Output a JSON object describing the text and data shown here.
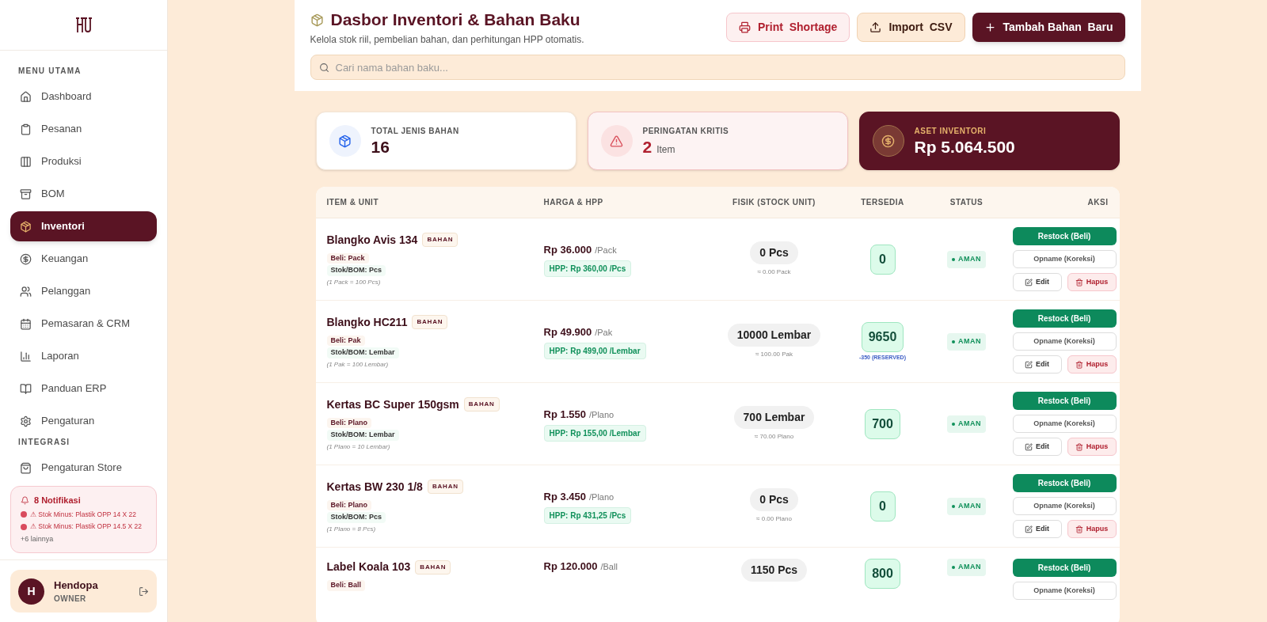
{
  "sidebar": {
    "sections": [
      {
        "title": "MENU UTAMA",
        "items": [
          {
            "label": "Dashboard",
            "selected": false
          },
          {
            "label": "Pesanan",
            "selected": false
          },
          {
            "label": "Produksi",
            "selected": false
          },
          {
            "label": "BOM",
            "selected": false
          },
          {
            "label": "Inventori",
            "selected": true
          },
          {
            "label": "Keuangan",
            "selected": false
          },
          {
            "label": "Pelanggan",
            "selected": false
          },
          {
            "label": "Pemasaran & CRM",
            "selected": false
          },
          {
            "label": "Laporan",
            "selected": false
          },
          {
            "label": "Panduan ERP",
            "selected": false
          },
          {
            "label": "Pengaturan",
            "selected": false
          }
        ]
      },
      {
        "title": "INTEGRASI",
        "items": [
          {
            "label": "Pengaturan Store",
            "selected": false
          }
        ]
      }
    ],
    "notifications": {
      "title": "8 Notifikasi",
      "items": [
        "⚠ Stok Minus: Plastik OPP 14 X 22",
        "⚠ Stok Minus: Plastik OPP 14.5 X 22"
      ],
      "more": "+6 lainnya"
    },
    "user": {
      "initial": "H",
      "name": "Hendopa",
      "role": "OWNER"
    }
  },
  "header": {
    "title": "Dasbor Inventori & Bahan Baku",
    "subtitle": "Kelola stok riil, pembelian bahan, dan perhitungan HPP otomatis.",
    "buttons": [
      {
        "label": "Print  Shortage",
        "kind": "print"
      },
      {
        "label": "Import  CSV",
        "kind": "import"
      },
      {
        "label": "Tambah Bahan  Baru",
        "kind": "add"
      }
    ],
    "search": {
      "placeholder": "Cari nama bahan baku..."
    }
  },
  "stats": [
    {
      "label": "TOTAL JENIS BAHAN",
      "value": "16",
      "kind": "total"
    },
    {
      "label": "PERINGATAN KRITIS",
      "value": "2",
      "unit": "Item",
      "kind": "warning"
    },
    {
      "label": "ASET INVENTORI",
      "value": "Rp 5.064.500",
      "kind": "asset"
    }
  ],
  "table": {
    "columns": [
      "ITEM & UNIT",
      "HARGA & HPP",
      "FISIK (STOCK UNIT)",
      "TERSEDIA",
      "STATUS",
      "AKSI"
    ],
    "rows": [
      {
        "name": "Blangko Avis 134",
        "tag": "BAHAN",
        "buy": "Beli: Pack",
        "stock_unit": "Stok/BOM: Pcs",
        "conversion": "(1 Pack = 100 Pcs)",
        "price": "Rp 36.000",
        "price_unit": "/Pack",
        "hpp": "HPP: Rp 360,00 /Pcs",
        "physical": "0 Pcs",
        "physical_approx": "≈ 0.00 Pack",
        "available": "0",
        "status": {
          "label": "AMAN",
          "kind": "safe"
        },
        "actions": [
          "Restock (Beli)",
          "Opname (Koreksi)",
          "Edit",
          "Hapus"
        ]
      },
      {
        "name": "Blangko HC211",
        "tag": "BAHAN",
        "buy": "Beli: Pak",
        "stock_unit": "Stok/BOM: Lembar",
        "conversion": "(1 Pak = 100 Lembar)",
        "price": "Rp 49.900",
        "price_unit": "/Pak",
        "hpp": "HPP: Rp 499,00 /Lembar",
        "physical": "10000 Lembar",
        "physical_approx": "≈ 100.00 Pak",
        "available": "9650",
        "reserved": "-350 (RESERVED)",
        "status": {
          "label": "AMAN",
          "kind": "safe"
        },
        "actions": [
          "Restock (Beli)",
          "Opname (Koreksi)",
          "Edit",
          "Hapus"
        ]
      },
      {
        "name": "Kertas BC Super 150gsm",
        "tag": "BAHAN",
        "buy": "Beli: Plano",
        "stock_unit": "Stok/BOM: Lembar",
        "conversion": "(1 Plano = 10 Lembar)",
        "price": "Rp 1.550",
        "price_unit": "/Plano",
        "hpp": "HPP: Rp 155,00 /Lembar",
        "physical": "700 Lembar",
        "physical_approx": "≈ 70.00 Plano",
        "available": "700",
        "status": {
          "label": "AMAN",
          "kind": "safe"
        },
        "actions": [
          "Restock (Beli)",
          "Opname (Koreksi)",
          "Edit",
          "Hapus"
        ]
      },
      {
        "name": "Kertas BW 230 1/8",
        "tag": "BAHAN",
        "buy": "Beli: Plano",
        "stock_unit": "Stok/BOM: Pcs",
        "conversion": "(1 Plano = 8 Pcs)",
        "price": "Rp 3.450",
        "price_unit": "/Plano",
        "hpp": "HPP: Rp 431,25 /Pcs",
        "physical": "0 Pcs",
        "physical_approx": "≈ 0.00 Plano",
        "available": "0",
        "status": {
          "label": "AMAN",
          "kind": "safe"
        },
        "actions": [
          "Restock (Beli)",
          "Opname (Koreksi)",
          "Edit",
          "Hapus"
        ]
      },
      {
        "name": "Label Koala 103",
        "tag": "BAHAN",
        "buy": "Beli: Ball",
        "price": "Rp 120.000",
        "price_unit": "/Ball",
        "physical": "1150 Pcs",
        "available": "800",
        "status": {
          "label": "AMAN",
          "kind": "safe"
        },
        "actions": [
          "Restock (Beli)",
          "Opname (Koreksi)"
        ]
      }
    ]
  }
}
